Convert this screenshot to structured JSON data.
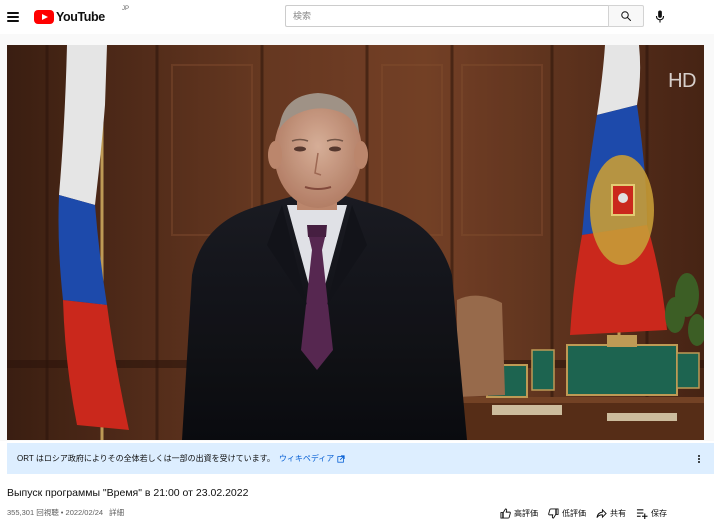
{
  "header": {
    "logo_text": "YouTube",
    "country_code": "JP",
    "search_placeholder": "検索"
  },
  "player": {
    "hd_badge": "HD"
  },
  "info_panel": {
    "text": "ORT はロシア政府によりその全体若しくは一部の出資を受けています。",
    "link_label": "ウィキペディア"
  },
  "video": {
    "title": "Выпуск программы \"Время\" в 21:00 от 23.02.2022",
    "views": "355,301 回視聴",
    "separator": "•",
    "date": "2022/02/24",
    "more_label": "詳細"
  },
  "actions": {
    "like_label": "高評価",
    "dislike_label": "低評価",
    "share_label": "共有",
    "save_label": "保存"
  },
  "colors": {
    "brand_red": "#ff0000",
    "link_blue": "#065fd4",
    "info_bg": "#ddeeff"
  }
}
